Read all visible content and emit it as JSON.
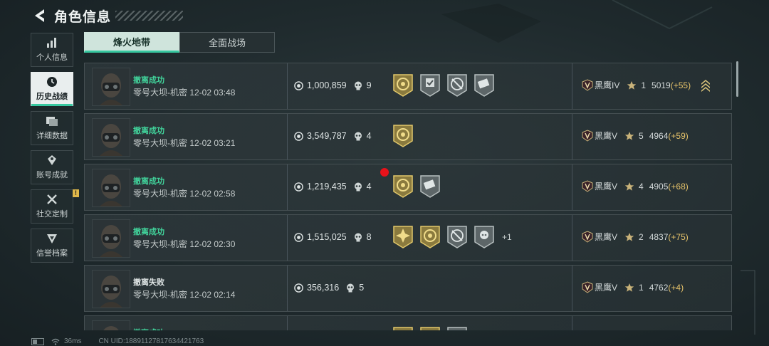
{
  "header": {
    "title": "角色信息",
    "back_icon": "back-arrow-icon"
  },
  "sidebar": {
    "items": [
      {
        "label": "个人信息",
        "icon": "bar-chart-icon",
        "active": false
      },
      {
        "label": "历史战绩",
        "icon": "clock-icon",
        "active": true
      },
      {
        "label": "详细数据",
        "icon": "cards-icon",
        "active": false
      },
      {
        "label": "账号成就",
        "icon": "medal-icon",
        "active": false
      },
      {
        "label": "社交定制",
        "icon": "tools-icon",
        "active": false,
        "notice": "!"
      },
      {
        "label": "信誉档案",
        "icon": "shield-icon",
        "active": false
      }
    ]
  },
  "tabs": [
    {
      "label": "烽火地带",
      "active": true
    },
    {
      "label": "全面战场",
      "active": false
    }
  ],
  "records": [
    {
      "result": "撤离成功",
      "success": true,
      "map": "零号大坝-机密 12-02 03:48",
      "value": "1,000,859",
      "kills": "9",
      "badges": [
        "gold-emblem-icon",
        "silver-check-icon",
        "silver-crossed-icon",
        "silver-card-icon"
      ],
      "more": "",
      "rank": "黑鹰IV",
      "stars": "1",
      "score": "5019",
      "delta": "(+55)",
      "rank_up": true
    },
    {
      "result": "撤离成功",
      "success": true,
      "map": "零号大坝-机密 12-02 03:21",
      "value": "3,549,787",
      "kills": "4",
      "badges": [
        "gold-emblem-icon"
      ],
      "more": "",
      "rank": "黑鹰V",
      "stars": "5",
      "score": "4964",
      "delta": "(+59)",
      "rank_up": false
    },
    {
      "result": "撤离成功",
      "success": true,
      "map": "零号大坝-机密 12-02 02:58",
      "value": "1,219,435",
      "kills": "4",
      "badges": [
        "gold-emblem-icon",
        "silver-card-icon"
      ],
      "more": "",
      "rank": "黑鹰V",
      "stars": "4",
      "score": "4905",
      "delta": "(+68)",
      "rank_up": false
    },
    {
      "result": "撤离成功",
      "success": true,
      "map": "零号大坝-机密 12-02 02:30",
      "value": "1,515,025",
      "kills": "8",
      "badges": [
        "gold-sun-icon",
        "gold-emblem-icon",
        "silver-crossed-icon",
        "silver-skull-icon"
      ],
      "more": "+1",
      "rank": "黑鹰V",
      "stars": "2",
      "score": "4837",
      "delta": "(+75)",
      "rank_up": false
    },
    {
      "result": "撤离失败",
      "success": false,
      "map": "零号大坝-机密 12-02 02:14",
      "value": "356,316",
      "kills": "5",
      "badges": [],
      "more": "",
      "rank": "黑鹰V",
      "stars": "1",
      "score": "4762",
      "delta": "(+4)",
      "rank_up": false
    },
    {
      "result": "撤离成功",
      "success": true,
      "map": "",
      "value": "",
      "kills": "",
      "badges": [
        "gold-emblem-icon",
        "gold-emblem-icon",
        "silver-card-icon"
      ],
      "more": "",
      "rank": "",
      "stars": "",
      "score": "",
      "delta": "",
      "rank_up": false
    }
  ],
  "status": {
    "ping": "36ms",
    "uid": "CN UID:188911278176344217​63"
  },
  "colors": {
    "accent": "#37c8a0",
    "success": "#41d39b",
    "gold": "#e6c36a",
    "marker": "#e8121a"
  }
}
